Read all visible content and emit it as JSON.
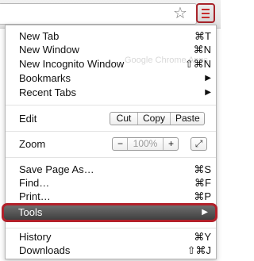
{
  "toolbar": {
    "star_icon": "☆",
    "ghost_text": "Google Chrome Apps"
  },
  "menu": {
    "new_tab": {
      "label": "New Tab",
      "shortcut": "⌘T"
    },
    "new_window": {
      "label": "New Window",
      "shortcut": "⌘N"
    },
    "new_incognito": {
      "label": "New Incognito Window",
      "shortcut": "⇧⌘N"
    },
    "bookmarks": {
      "label": "Bookmarks"
    },
    "recent_tabs": {
      "label": "Recent Tabs"
    },
    "edit": {
      "label": "Edit",
      "cut": "Cut",
      "copy": "Copy",
      "paste": "Paste"
    },
    "zoom": {
      "label": "Zoom",
      "minus": "−",
      "value": "100%",
      "plus": "+"
    },
    "save_page": {
      "label": "Save Page As…",
      "shortcut": "⌘S"
    },
    "find": {
      "label": "Find…",
      "shortcut": "⌘F"
    },
    "print": {
      "label": "Print…",
      "shortcut": "⌘P"
    },
    "tools": {
      "label": "Tools"
    },
    "history": {
      "label": "History",
      "shortcut": "⌘Y"
    },
    "downloads": {
      "label": "Downloads",
      "shortcut": "⇧⌘J"
    },
    "submenu_arrow": "▶"
  },
  "colors": {
    "highlight_border": "#b3202a",
    "menu_icon": "#c62c2c"
  }
}
